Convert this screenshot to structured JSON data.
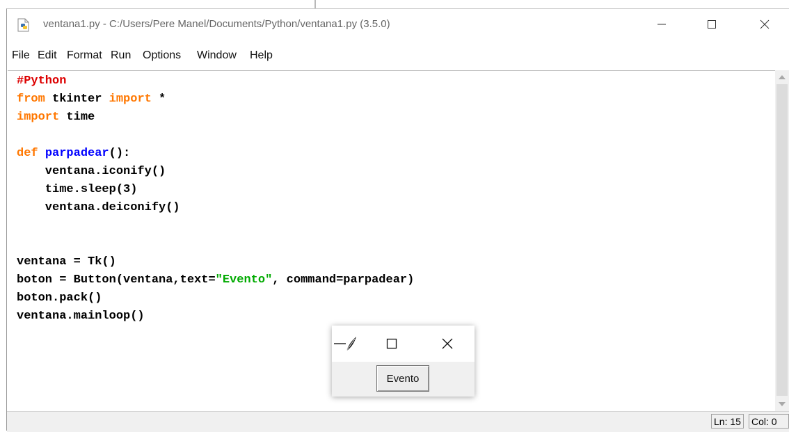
{
  "window": {
    "title": "ventana1.py - C:/Users/Pere Manel/Documents/Python/ventana1.py (3.5.0)",
    "icon": "python-file-icon"
  },
  "menu": [
    "File",
    "Edit",
    "Format",
    "Run",
    "Options",
    "Window",
    "Help"
  ],
  "code": {
    "line1": {
      "comment": "#Python"
    },
    "line2": {
      "kw_from": "from",
      "mod": " tkinter ",
      "kw_import": "import",
      "rest": " *"
    },
    "line3": {
      "kw_import": "import",
      "rest": " time"
    },
    "line5": {
      "kw_def": "def",
      "sp": " ",
      "fname": "parpadear",
      "rest": "():"
    },
    "line6": {
      "text": "    ventana.iconify()"
    },
    "line7": {
      "text": "    time.sleep(3)"
    },
    "line8": {
      "text": "    ventana.deiconify()"
    },
    "line11": {
      "text": "ventana = Tk()"
    },
    "line12": {
      "pre": "boton = Button(ventana,text=",
      "string": "\"Evento\"",
      "post": ", command=parpadear)"
    },
    "line13": {
      "text": "boton.pack()"
    },
    "line14": {
      "text": "ventana.mainloop()"
    }
  },
  "status": {
    "line": "Ln: 15",
    "col": "Col: 0"
  },
  "tk_window": {
    "button_label": "Evento",
    "icon": "tk-feather-icon"
  },
  "colors": {
    "comment": "#dd0000",
    "keyword": "#ff7700",
    "definition": "#0000ff",
    "string": "#00aa00"
  }
}
